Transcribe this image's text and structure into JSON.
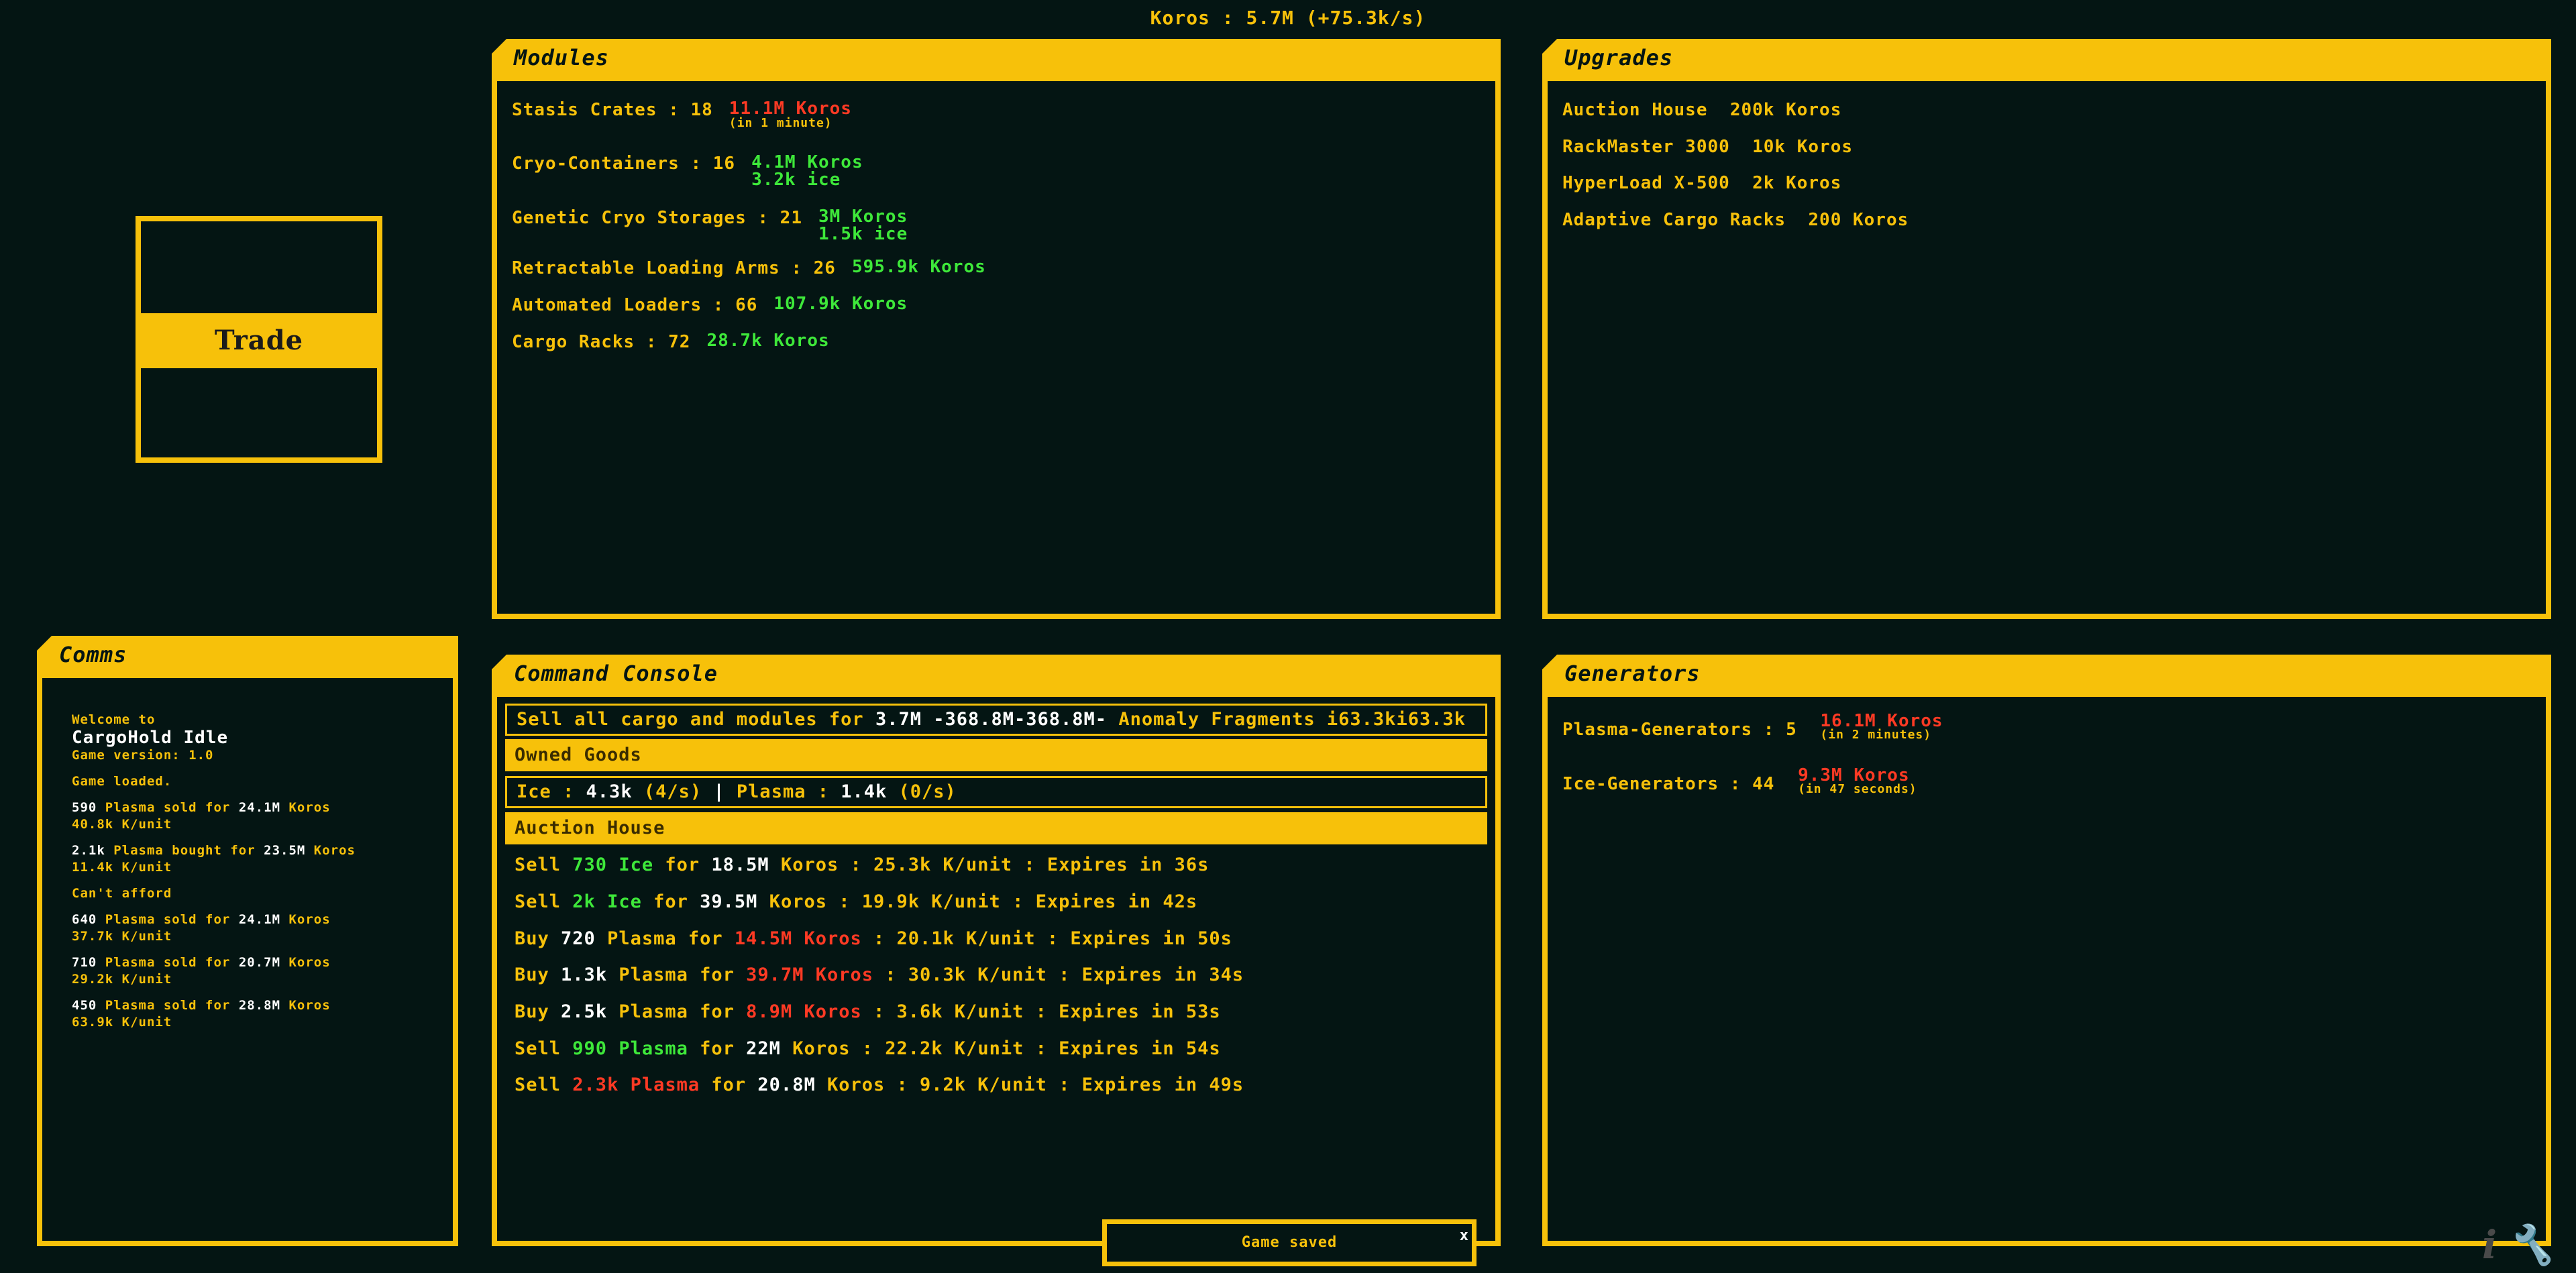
{
  "topbar": {
    "text": "Koros : 5.7M (+75.3k/s)"
  },
  "trade": {
    "label": "Trade"
  },
  "modules": {
    "title": "Modules",
    "items": [
      {
        "label": "Stasis Crates : 18",
        "values": [
          {
            "text": "11.1M Koros",
            "color": "#ff3a24"
          }
        ],
        "sub": "(in 1 minute)",
        "sub_color": "#f7c10a"
      },
      {
        "label": "Cryo-Containers : 16",
        "values": [
          {
            "text": "4.1M Koros",
            "color": "#3ee83a"
          },
          {
            "text": "3.2k ice",
            "color": "#3ee83a"
          }
        ]
      },
      {
        "label": "Genetic Cryo Storages : 21",
        "values": [
          {
            "text": "3M Koros",
            "color": "#3ee83a"
          },
          {
            "text": "1.5k ice",
            "color": "#3ee83a"
          }
        ]
      },
      {
        "label": "Retractable Loading Arms : 26",
        "values": [
          {
            "text": "595.9k Koros",
            "color": "#3ee83a"
          }
        ]
      },
      {
        "label": "Automated Loaders : 66",
        "values": [
          {
            "text": "107.9k Koros",
            "color": "#3ee83a"
          }
        ]
      },
      {
        "label": "Cargo Racks : 72",
        "values": [
          {
            "text": "28.7k Koros",
            "color": "#3ee83a"
          }
        ]
      }
    ]
  },
  "upgrades": {
    "title": "Upgrades",
    "items": [
      {
        "name": "Auction House",
        "cost": "200k Koros"
      },
      {
        "name": "RackMaster 3000",
        "cost": "10k Koros"
      },
      {
        "name": "HyperLoad X-500",
        "cost": "2k Koros"
      },
      {
        "name": "Adaptive Cargo Racks",
        "cost": "200 Koros"
      }
    ]
  },
  "comms": {
    "title": "Comms",
    "welcome": "Welcome to",
    "game_name": "CargoHold Idle",
    "version": "Game version: 1.0",
    "loaded": "Game loaded.",
    "cant_afford": "Can't afford",
    "trades": [
      {
        "qty": "590",
        "action": "Plasma sold for",
        "amount": "24.1M",
        "unit": "Koros",
        "rate": "40.8k K/unit"
      },
      {
        "qty": "2.1k",
        "action": "Plasma bought for",
        "amount": "23.5M",
        "unit": "Koros",
        "rate": "11.4k K/unit"
      },
      {
        "qty": "640",
        "action": "Plasma sold for",
        "amount": "24.1M",
        "unit": "Koros",
        "rate": "37.7k K/unit"
      },
      {
        "qty": "710",
        "action": "Plasma sold for",
        "amount": "20.7M",
        "unit": "Koros",
        "rate": "29.2k K/unit"
      },
      {
        "qty": "450",
        "action": "Plasma sold for",
        "amount": "28.8M",
        "unit": "Koros",
        "rate": "63.9k K/unit"
      }
    ]
  },
  "console": {
    "title": "Command Console",
    "sell_all": {
      "prefix": "Sell all cargo and modules for",
      "amount": "3.7M -368.8M-368.8M-",
      "suffix": "Anomaly Fragments i63.3ki63.3k"
    },
    "owned_goods_header": "Owned Goods",
    "owned": {
      "ice_label": "Ice :",
      "ice_value": "4.3k",
      "ice_rate": "(4/s)",
      "sep": "|",
      "plasma_label": "Plasma :",
      "plasma_value": "1.4k",
      "plasma_rate": "(0/s)"
    },
    "auction_header": "Auction House",
    "offers": [
      {
        "verb": "Sell",
        "qty": "730",
        "good": "Ice",
        "good_color": "#3ee83a",
        "price": "18.5M",
        "price_suffix": "Koros",
        "price_color": "#ffffff",
        "rest": ": 25.3k K/unit : Expires in 36s"
      },
      {
        "verb": "Sell",
        "qty": "2k",
        "good": "Ice",
        "good_color": "#3ee83a",
        "price": "39.5M",
        "price_suffix": "Koros",
        "price_color": "#ffffff",
        "rest": ": 19.9k K/unit : Expires in 42s"
      },
      {
        "verb": "Buy",
        "qty": "720",
        "good": "Plasma",
        "good_color": "#f7c10a",
        "price": "14.5M",
        "price_suffix": "Koros",
        "price_color": "#ff3a24",
        "rest": ": 20.1k K/unit : Expires in 50s"
      },
      {
        "verb": "Buy",
        "qty": "1.3k",
        "good": "Plasma",
        "good_color": "#f7c10a",
        "price": "39.7M",
        "price_suffix": "Koros",
        "price_color": "#ff3a24",
        "rest": ": 30.3k K/unit : Expires in 34s"
      },
      {
        "verb": "Buy",
        "qty": "2.5k",
        "good": "Plasma",
        "good_color": "#f7c10a",
        "price": "8.9M",
        "price_suffix": "Koros",
        "price_color": "#ff3a24",
        "rest": ": 3.6k K/unit : Expires in 53s"
      },
      {
        "verb": "Sell",
        "qty": "990",
        "good": "Plasma",
        "good_color": "#3ee83a",
        "price": "22M",
        "price_suffix": "Koros",
        "price_color": "#ffffff",
        "rest": ": 22.2k K/unit : Expires in 54s"
      },
      {
        "verb": "Sell",
        "qty": "2.3k",
        "good": "Plasma",
        "good_color": "#ff3a24",
        "price": "20.8M",
        "price_suffix": "Koros",
        "price_color": "#ffffff",
        "rest": ": 9.2k K/unit : Expires in 49s"
      }
    ]
  },
  "generators": {
    "title": "Generators",
    "items": [
      {
        "label": "Plasma-Generators : 5",
        "value": "16.1M Koros",
        "sub": "(in 2 minutes)"
      },
      {
        "label": "Ice-Generators : 44",
        "value": "9.3M Koros",
        "sub": "(in 47 seconds)"
      }
    ]
  },
  "toast": {
    "text": "Game saved",
    "close": "x"
  },
  "corner": {
    "info_glyph": "i",
    "settings_glyph": "🔧"
  },
  "colors": {
    "accent": "#f7c10a",
    "background": "#041513",
    "positive": "#3ee83a",
    "negative": "#ff3a24"
  }
}
